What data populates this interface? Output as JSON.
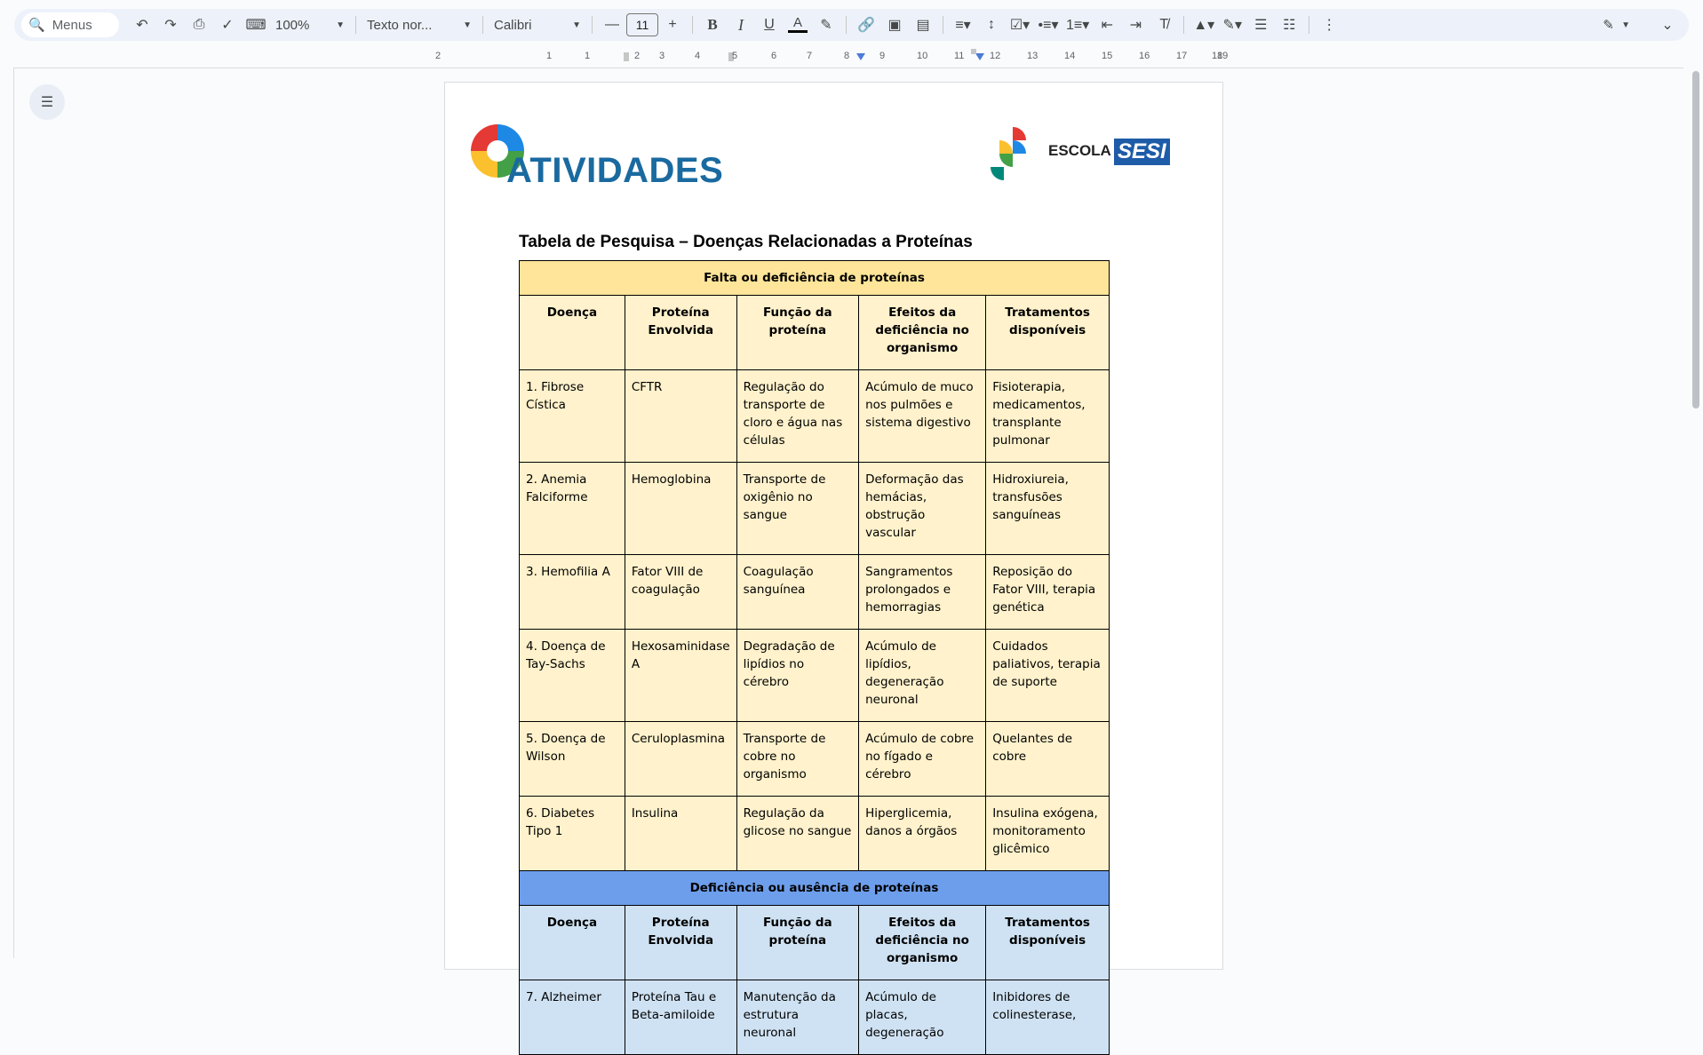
{
  "toolbar": {
    "search_label": "Menus",
    "zoom": "100%",
    "style": "Texto nor...",
    "font": "Calibri",
    "font_size": "11"
  },
  "ruler": [
    "2",
    "1",
    "1",
    "2",
    "3",
    "4",
    "5",
    "6",
    "7",
    "8",
    "9",
    "10",
    "11",
    "12",
    "13",
    "14",
    "15",
    "16",
    "17",
    "18",
    "19"
  ],
  "logos": {
    "left_word": "ATIVIDADES",
    "right_word": "ESCOLA",
    "right_brand": "SESI"
  },
  "document": {
    "title": "Tabela de Pesquisa – Doenças Relacionadas a Proteínas",
    "columns": [
      "Doença",
      "Proteína Envolvida",
      "Função da proteína",
      "Efeitos da deficiência no organismo",
      "Tratamentos disponíveis"
    ],
    "section1": {
      "title": "Falta ou deficiência de proteínas",
      "rows": [
        [
          "1. Fibrose Cística",
          "CFTR",
          "Regulação do transporte de cloro e água nas células",
          "Acúmulo de muco nos pulmões e sistema digestivo",
          "Fisioterapia, medicamentos, transplante pulmonar"
        ],
        [
          "2. Anemia Falciforme",
          "Hemoglobina",
          "Transporte de oxigênio no sangue",
          "Deformação das hemácias, obstrução vascular",
          "Hidroxiureia, transfusões sanguíneas"
        ],
        [
          "3. Hemofilia A",
          "Fator VIII de coagulação",
          "Coagulação sanguínea",
          "Sangramentos prolongados e hemorragias",
          "Reposição do Fator VIII, terapia genética"
        ],
        [
          "4. Doença de Tay-Sachs",
          "Hexosaminidase A",
          "Degradação de lipídios no cérebro",
          "Acúmulo de lipídios, degeneração neuronal",
          "Cuidados paliativos, terapia de suporte"
        ],
        [
          "5. Doença de Wilson",
          "Ceruloplasmina",
          "Transporte de cobre no organismo",
          "Acúmulo de cobre no fígado e cérebro",
          "Quelantes de cobre"
        ],
        [
          "6. Diabetes Tipo 1",
          "Insulina",
          "Regulação da glicose no sangue",
          "Hiperglicemia, danos a órgãos",
          "Insulina exógena, monitoramento glicêmico"
        ]
      ]
    },
    "section2": {
      "title": "Deficiência ou ausência de proteínas",
      "rows": [
        [
          "7. Alzheimer",
          "Proteína Tau e Beta-amiloide",
          "Manutenção da estrutura neuronal",
          "Acúmulo de placas, degeneração",
          "Inibidores de colinesterase,"
        ]
      ]
    }
  },
  "colors": {
    "section1_head": "#ffe599",
    "section1_body": "#fff2cc",
    "section2_head": "#6d9eeb",
    "section2_body": "#cfe2f3"
  }
}
